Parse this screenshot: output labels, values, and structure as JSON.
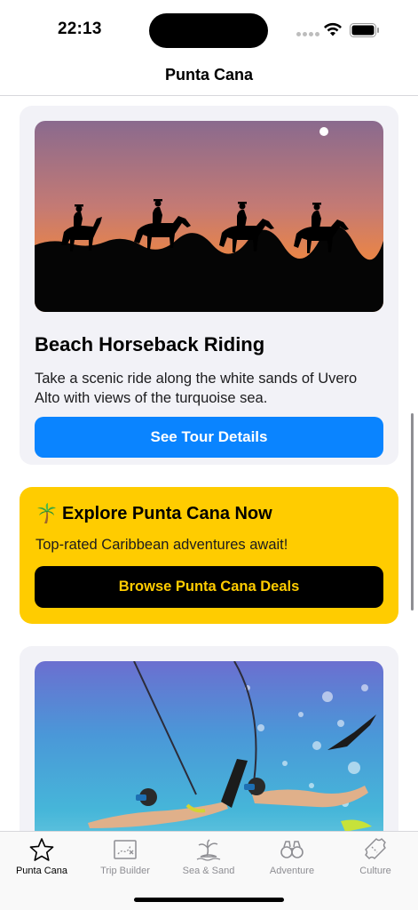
{
  "status_bar": {
    "time": "22:13",
    "icons": [
      "signal-dots-icon",
      "wifi-icon",
      "battery-icon"
    ]
  },
  "nav": {
    "title": "Punta Cana"
  },
  "tour_card": {
    "image": "horseback-silhouettes-sunset",
    "title": "Beach Horseback Riding",
    "description": "Take a scenic ride along the white sands of Uvero Alto with views of the turquoise sea.",
    "button_label": "See Tour Details"
  },
  "promo_card": {
    "icon": "palm-tree-icon",
    "title": "Explore Punta Cana Now",
    "subtitle": "Top-rated Caribbean adventures await!",
    "button_label": "Browse Punta Cana Deals",
    "colors": {
      "background": "#ffcc00",
      "button": "#000000"
    }
  },
  "snorkel_card": {
    "image": "snorkeling-underwater"
  },
  "tabs": [
    {
      "label": "Punta Cana",
      "icon": "star-icon",
      "active": true
    },
    {
      "label": "Trip Builder",
      "icon": "map-icon",
      "active": false
    },
    {
      "label": "Sea & Sand",
      "icon": "island-icon",
      "active": false
    },
    {
      "label": "Adventure",
      "icon": "binoculars-icon",
      "active": false
    },
    {
      "label": "Culture",
      "icon": "ticket-icon",
      "active": false
    }
  ],
  "colors": {
    "accent": "#0a84ff",
    "inactive_tab": "#8e8e93"
  }
}
